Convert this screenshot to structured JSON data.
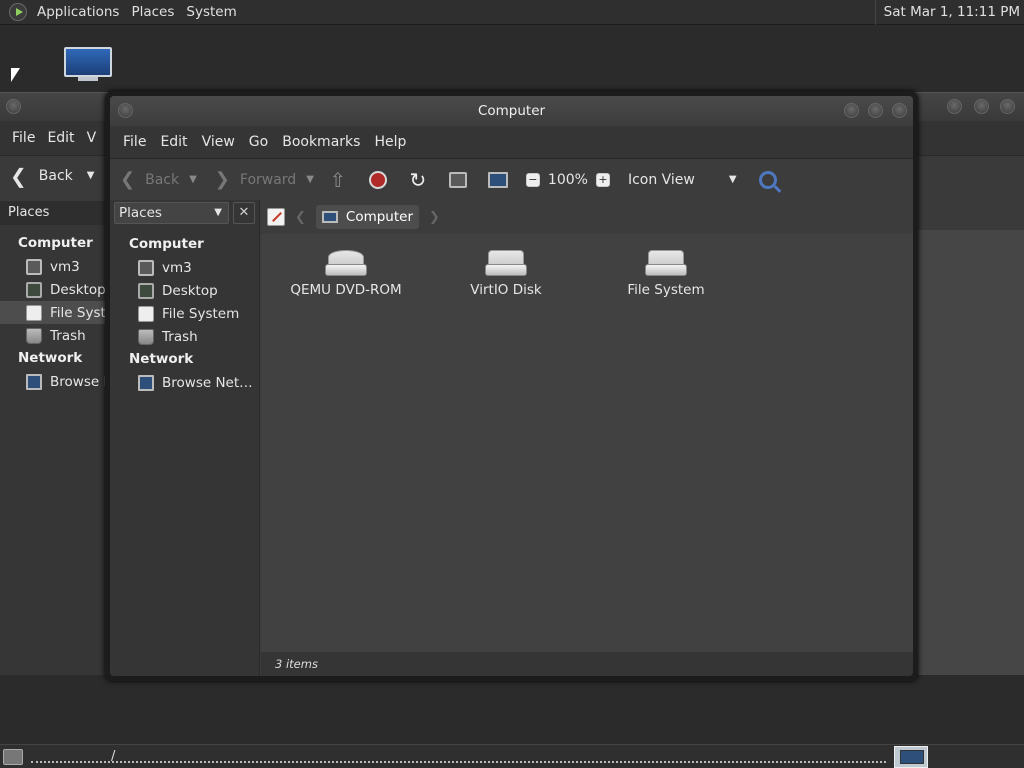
{
  "top_panel": {
    "menu": [
      "Applications",
      "Places",
      "System"
    ],
    "clock": "Sat Mar  1, 11:11 PM"
  },
  "bg_window": {
    "menu": [
      "File",
      "Edit",
      "V"
    ],
    "back_label": "Back",
    "places_label": "Places",
    "sidebar": [
      {
        "type": "head",
        "label": "Computer"
      },
      {
        "type": "item",
        "label": "vm3",
        "icon": "home-icon"
      },
      {
        "type": "item",
        "label": "Desktop",
        "icon": "desktop-icon"
      },
      {
        "type": "item",
        "label": "File Syste",
        "icon": "filesystem-icon",
        "selected": true
      },
      {
        "type": "item",
        "label": "Trash",
        "icon": "trash-icon"
      },
      {
        "type": "head",
        "label": "Network"
      },
      {
        "type": "item",
        "label": "Browse N",
        "icon": "network-icon"
      }
    ]
  },
  "window": {
    "title": "Computer",
    "menu": [
      "File",
      "Edit",
      "View",
      "Go",
      "Bookmarks",
      "Help"
    ],
    "toolbar": {
      "back": "Back",
      "forward": "Forward",
      "zoom": "100%",
      "view_mode": "Icon View"
    },
    "sidebar": {
      "selector": "Places",
      "close": "✕",
      "items": [
        {
          "type": "head",
          "label": "Computer"
        },
        {
          "type": "item",
          "label": "vm3",
          "icon": "home-icon"
        },
        {
          "type": "item",
          "label": "Desktop",
          "icon": "desktop-icon"
        },
        {
          "type": "item",
          "label": "File System",
          "icon": "filesystem-icon"
        },
        {
          "type": "item",
          "label": "Trash",
          "icon": "trash-icon"
        },
        {
          "type": "head",
          "label": "Network"
        },
        {
          "type": "item",
          "label": "Browse Net…",
          "icon": "network-icon"
        }
      ]
    },
    "location": "Computer",
    "files": [
      {
        "label": "QEMU DVD-ROM",
        "icon": "dvd-drive-icon"
      },
      {
        "label": "VirtIO Disk",
        "icon": "hard-disk-icon"
      },
      {
        "label": "File System",
        "icon": "hard-disk-icon"
      }
    ],
    "status": "3 items"
  },
  "bottom_panel": {
    "slash": "/"
  }
}
